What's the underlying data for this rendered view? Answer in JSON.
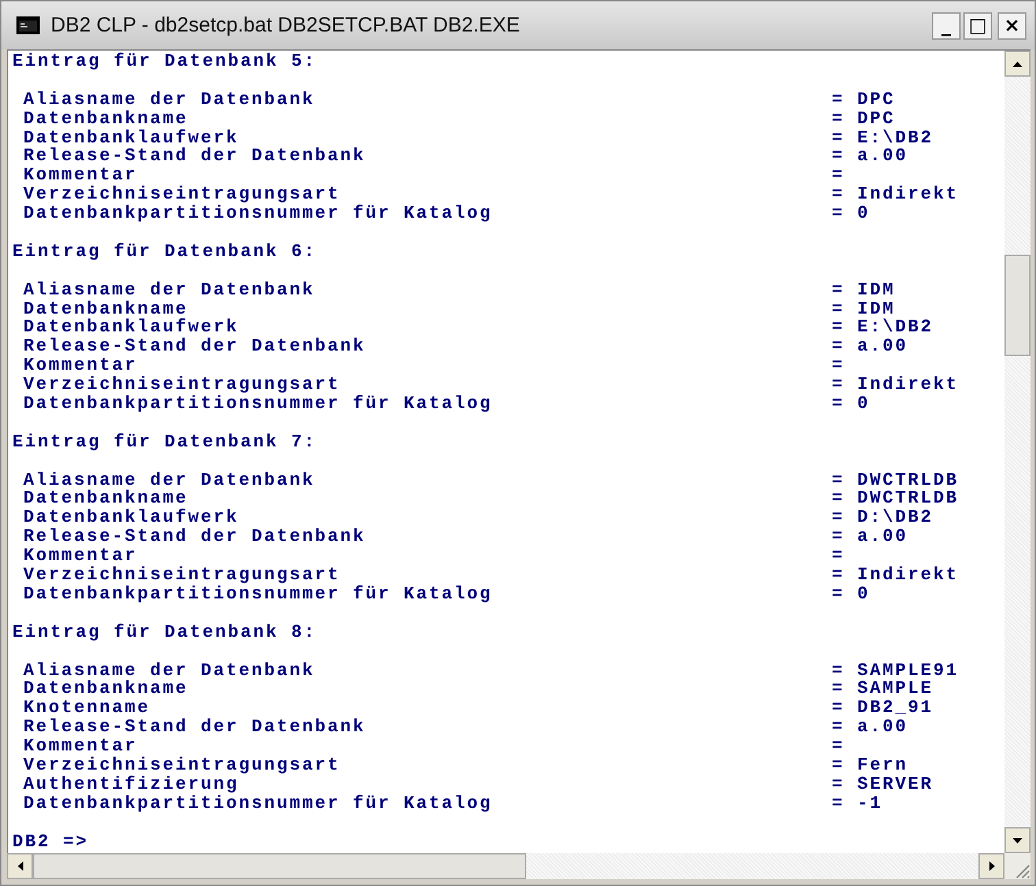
{
  "window": {
    "title": "DB2 CLP - db2setcp.bat DB2SETCP.BAT DB2.EXE",
    "buttons": [
      {
        "kind": "minimize",
        "label": "_"
      },
      {
        "kind": "maximize",
        "label": "□"
      },
      {
        "kind": "close",
        "label": "×"
      }
    ]
  },
  "entries": [
    {
      "title": "Eintrag für Datenbank 5:",
      "fields": [
        {
          "label": "Aliasname der Datenbank",
          "value": "= DPC"
        },
        {
          "label": "Datenbankname",
          "value": "= DPC"
        },
        {
          "label": "Datenbanklaufwerk",
          "value": "= E:\\DB2"
        },
        {
          "label": "Release-Stand der Datenbank",
          "value": "= a.00"
        },
        {
          "label": "Kommentar",
          "value": "="
        },
        {
          "label": "Verzeichniseintragungsart",
          "value": "= Indirekt"
        },
        {
          "label": "Datenbankpartitionsnummer für Katalog",
          "value": "= 0"
        }
      ]
    },
    {
      "title": "Eintrag für Datenbank 6:",
      "fields": [
        {
          "label": "Aliasname der Datenbank",
          "value": "= IDM"
        },
        {
          "label": "Datenbankname",
          "value": "= IDM"
        },
        {
          "label": "Datenbanklaufwerk",
          "value": "= E:\\DB2"
        },
        {
          "label": "Release-Stand der Datenbank",
          "value": "= a.00"
        },
        {
          "label": "Kommentar",
          "value": "="
        },
        {
          "label": "Verzeichniseintragungsart",
          "value": "= Indirekt"
        },
        {
          "label": "Datenbankpartitionsnummer für Katalog",
          "value": "= 0"
        }
      ]
    },
    {
      "title": "Eintrag für Datenbank 7:",
      "fields": [
        {
          "label": "Aliasname der Datenbank",
          "value": "= DWCTRLDB"
        },
        {
          "label": "Datenbankname",
          "value": "= DWCTRLDB"
        },
        {
          "label": "Datenbanklaufwerk",
          "value": "= D:\\DB2"
        },
        {
          "label": "Release-Stand der Datenbank",
          "value": "= a.00"
        },
        {
          "label": "Kommentar",
          "value": "="
        },
        {
          "label": "Verzeichniseintragungsart",
          "value": "= Indirekt"
        },
        {
          "label": "Datenbankpartitionsnummer für Katalog",
          "value": "= 0"
        }
      ]
    },
    {
      "title": "Eintrag für Datenbank 8:",
      "fields": [
        {
          "label": "Aliasname der Datenbank",
          "value": "= SAMPLE91"
        },
        {
          "label": "Datenbankname",
          "value": "= SAMPLE"
        },
        {
          "label": "Knotenname",
          "value": "= DB2_91"
        },
        {
          "label": "Release-Stand der Datenbank",
          "value": "= a.00"
        },
        {
          "label": "Kommentar",
          "value": "="
        },
        {
          "label": "Verzeichniseintragungsart",
          "value": "= Fern"
        },
        {
          "label": "Authentifizierung",
          "value": "= SERVER"
        },
        {
          "label": "Datenbankpartitionsnummer für Katalog",
          "value": "= -1"
        }
      ]
    }
  ],
  "prompt": "DB2 =>"
}
